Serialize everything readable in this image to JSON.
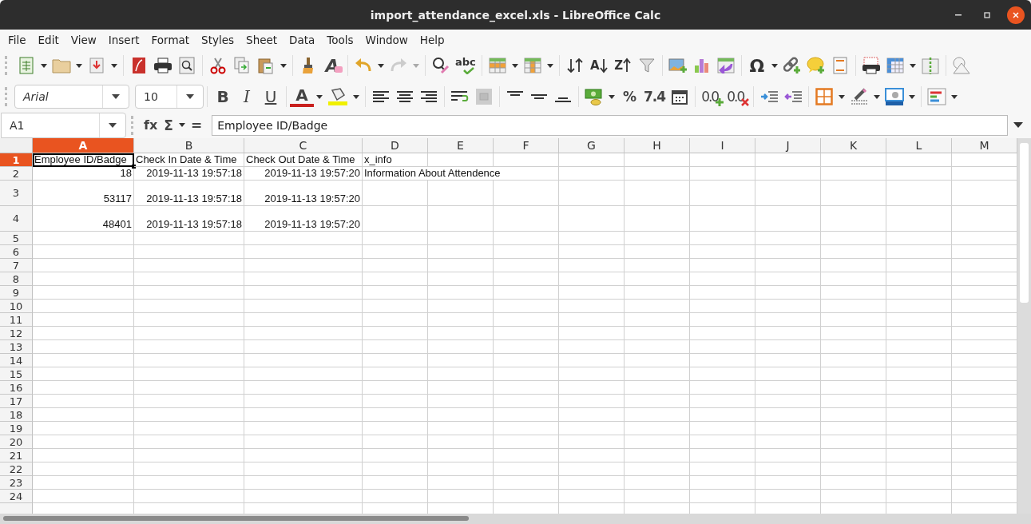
{
  "window": {
    "title": "import_attendance_excel.xls - LibreOffice Calc"
  },
  "menu": [
    "File",
    "Edit",
    "View",
    "Insert",
    "Format",
    "Styles",
    "Sheet",
    "Data",
    "Tools",
    "Window",
    "Help"
  ],
  "toolbar_glyphs": {
    "spelling": "abc",
    "sort_ascending": "A",
    "sort_descending": "Z",
    "special_character": "Ω",
    "clear_format": "A"
  },
  "formatting": {
    "font_name": "Arial",
    "font_size": "10",
    "bold": "B",
    "italic": "I",
    "underline": "U",
    "font_color": "A",
    "percent": "%",
    "number": "7.4",
    "add_decimal": "0.0",
    "delete_decimal": "0.0"
  },
  "formula_bar": {
    "name_box": "A1",
    "function_wizard": "fx",
    "sum": "Σ",
    "formula": "=",
    "content": "Employee ID/Badge"
  },
  "columns": [
    {
      "label": "A",
      "selected": true
    },
    {
      "label": "B",
      "selected": false
    },
    {
      "label": "C",
      "selected": false
    },
    {
      "label": "D",
      "selected": false
    },
    {
      "label": "E",
      "selected": false
    },
    {
      "label": "F",
      "selected": false
    },
    {
      "label": "G",
      "selected": false
    },
    {
      "label": "H",
      "selected": false
    },
    {
      "label": "I",
      "selected": false
    },
    {
      "label": "J",
      "selected": false
    },
    {
      "label": "K",
      "selected": false
    },
    {
      "label": "L",
      "selected": false
    },
    {
      "label": "M",
      "selected": false
    }
  ],
  "rows": [
    {
      "label": "1",
      "selected": true,
      "tall": false,
      "cells": [
        {
          "text": "Employee ID/Badge",
          "kind": "text",
          "selected": true
        },
        {
          "text": "Check In Date & Time",
          "kind": "text",
          "selected": false
        },
        {
          "text": "Check Out Date & Time",
          "kind": "text",
          "selected": false
        },
        {
          "text": "x_info",
          "kind": "text",
          "selected": false
        }
      ]
    },
    {
      "label": "2",
      "selected": false,
      "tall": false,
      "cells": [
        {
          "text": "18",
          "kind": "number",
          "selected": false
        },
        {
          "text": "2019-11-13 19:57:18",
          "kind": "number",
          "selected": false
        },
        {
          "text": "2019-11-13 19:57:20",
          "kind": "number",
          "selected": false
        },
        {
          "text": "Information About Attendence",
          "kind": "text",
          "selected": false
        }
      ]
    },
    {
      "label": "3",
      "selected": false,
      "tall": true,
      "cells": [
        {
          "text": "53117",
          "kind": "number",
          "selected": false
        },
        {
          "text": "2019-11-13 19:57:18",
          "kind": "number",
          "selected": false
        },
        {
          "text": "2019-11-13 19:57:20",
          "kind": "number",
          "selected": false
        }
      ]
    },
    {
      "label": "4",
      "selected": false,
      "tall": true,
      "cells": [
        {
          "text": "48401",
          "kind": "number",
          "selected": false
        },
        {
          "text": "2019-11-13 19:57:18",
          "kind": "number",
          "selected": false
        },
        {
          "text": "2019-11-13 19:57:20",
          "kind": "number",
          "selected": false
        }
      ]
    },
    {
      "label": "5",
      "selected": false,
      "tall": false
    },
    {
      "label": "6",
      "selected": false,
      "tall": false
    },
    {
      "label": "7",
      "selected": false,
      "tall": false
    },
    {
      "label": "8",
      "selected": false,
      "tall": false
    },
    {
      "label": "9",
      "selected": false,
      "tall": false
    },
    {
      "label": "10",
      "selected": false,
      "tall": false
    },
    {
      "label": "11",
      "selected": false,
      "tall": false
    },
    {
      "label": "12",
      "selected": false,
      "tall": false
    },
    {
      "label": "13",
      "selected": false,
      "tall": false
    },
    {
      "label": "14",
      "selected": false,
      "tall": false
    },
    {
      "label": "15",
      "selected": false,
      "tall": false
    },
    {
      "label": "16",
      "selected": false,
      "tall": false
    },
    {
      "label": "17",
      "selected": false,
      "tall": false
    },
    {
      "label": "18",
      "selected": false,
      "tall": false
    },
    {
      "label": "19",
      "selected": false,
      "tall": false
    },
    {
      "label": "20",
      "selected": false,
      "tall": false
    },
    {
      "label": "21",
      "selected": false,
      "tall": false
    },
    {
      "label": "22",
      "selected": false,
      "tall": false
    },
    {
      "label": "23",
      "selected": false,
      "tall": false
    },
    {
      "label": "24",
      "selected": false,
      "tall": false
    }
  ]
}
